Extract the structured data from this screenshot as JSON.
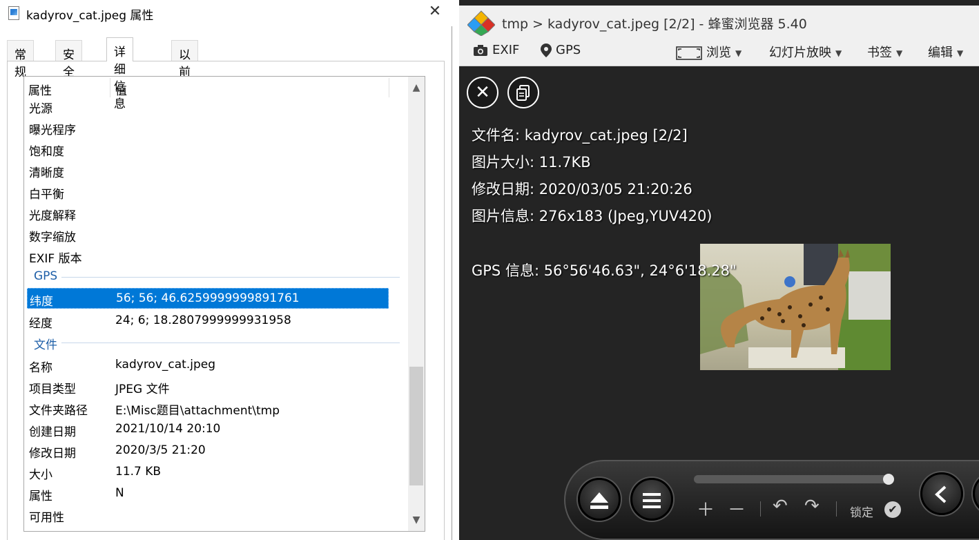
{
  "dialog": {
    "title": "kadyrov_cat.jpeg 属性",
    "tabs": [
      "常规",
      "安全",
      "详细信息",
      "以前的版本"
    ],
    "active_tab": "详细信息",
    "columns": {
      "property": "属性",
      "value": "值"
    },
    "rows_top": [
      {
        "key": "光源",
        "value": ""
      },
      {
        "key": "曝光程序",
        "value": ""
      },
      {
        "key": "饱和度",
        "value": ""
      },
      {
        "key": "清晰度",
        "value": ""
      },
      {
        "key": "白平衡",
        "value": ""
      },
      {
        "key": "光度解释",
        "value": ""
      },
      {
        "key": "数字缩放",
        "value": ""
      },
      {
        "key": "EXIF 版本",
        "value": ""
      }
    ],
    "group_gps": "GPS",
    "rows_gps": [
      {
        "key": "纬度",
        "value": "56; 56; 46.6259999999891761"
      },
      {
        "key": "经度",
        "value": "24; 6; 18.2807999999931958"
      }
    ],
    "group_file": "文件",
    "rows_file": [
      {
        "key": "名称",
        "value": "kadyrov_cat.jpeg"
      },
      {
        "key": "项目类型",
        "value": "JPEG 文件"
      },
      {
        "key": "文件夹路径",
        "value": "E:\\Misc题目\\attachment\\tmp"
      },
      {
        "key": "创建日期",
        "value": "2021/10/14 20:10"
      },
      {
        "key": "修改日期",
        "value": "2020/3/5 21:20"
      },
      {
        "key": "大小",
        "value": "11.7 KB"
      },
      {
        "key": "属性",
        "value": "N"
      },
      {
        "key": "可用性",
        "value": ""
      }
    ],
    "selected_row": "纬度",
    "colors": {
      "selection": "#0078d7",
      "group_text": "#1e5fa8"
    }
  },
  "viewer": {
    "title": "tmp > kadyrov_cat.jpeg [2/2] - 蜂蜜浏览器 5.40",
    "toolbar": {
      "exif": "EXIF",
      "gps": "GPS",
      "browse": "浏览",
      "slideshow": "幻灯片放映",
      "bookmarks": "书签",
      "edit": "编辑"
    },
    "info": {
      "filename": "文件名: kadyrov_cat.jpeg [2/2]",
      "size": "图片大小: 11.7KB",
      "modified": "修改日期: 2020/03/05 21:20:26",
      "image_info": "图片信息: 276x183 (Jpeg,YUV420)",
      "gps": "GPS 信息: 56°56'46.63\", 24°6'18.28\""
    },
    "controls": {
      "lock_label": "锁定"
    },
    "icons": [
      "close-icon",
      "copy-icon",
      "camera-icon",
      "pin-icon",
      "eject-icon",
      "menu-icon",
      "back-icon",
      "plus-icon",
      "minus-icon",
      "rotate-left-icon",
      "rotate-right-icon",
      "check-icon"
    ],
    "colors": {
      "background": "#242424",
      "toolbar": "#f0f0f0"
    }
  }
}
